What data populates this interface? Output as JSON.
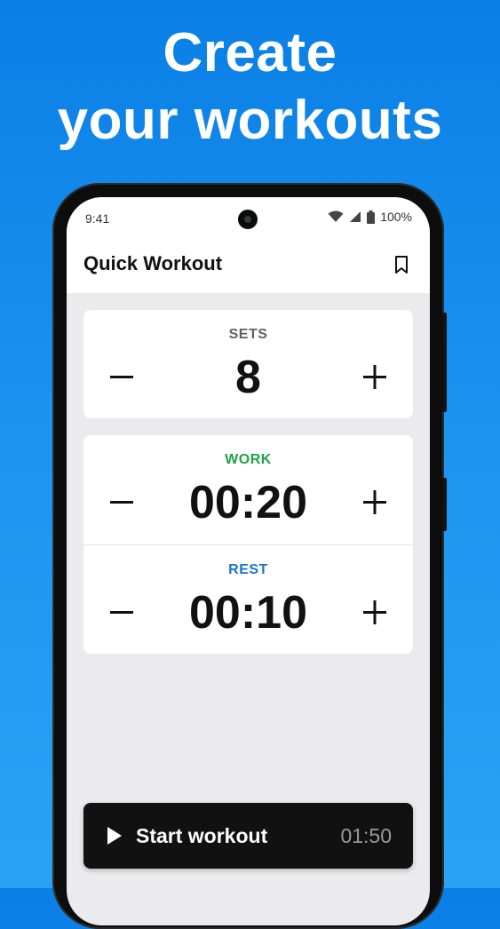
{
  "headline": {
    "line1": "Create",
    "line2": "your workouts"
  },
  "status_bar": {
    "time": "9:41",
    "battery": "100%",
    "icons": [
      "wifi-icon",
      "signal-icon",
      "battery-icon"
    ]
  },
  "app_bar": {
    "title": "Quick Workout",
    "action_icon": "bookmark-icon"
  },
  "sets": {
    "label": "SETS",
    "value": "8",
    "label_color": "#5f6368"
  },
  "work": {
    "label": "WORK",
    "value": "00:20",
    "label_color": "#1aa34a"
  },
  "rest": {
    "label": "REST",
    "value": "00:10",
    "label_color": "#1a73c8"
  },
  "controls": {
    "minus_icon": "minus-icon",
    "plus_icon": "plus-icon"
  },
  "start": {
    "label": "Start workout",
    "total_time": "01:50",
    "icon": "play-icon"
  },
  "colors": {
    "background": "#1a8fee",
    "card": "#ffffff",
    "screen": "#ebebee",
    "start_button": "#111111"
  }
}
